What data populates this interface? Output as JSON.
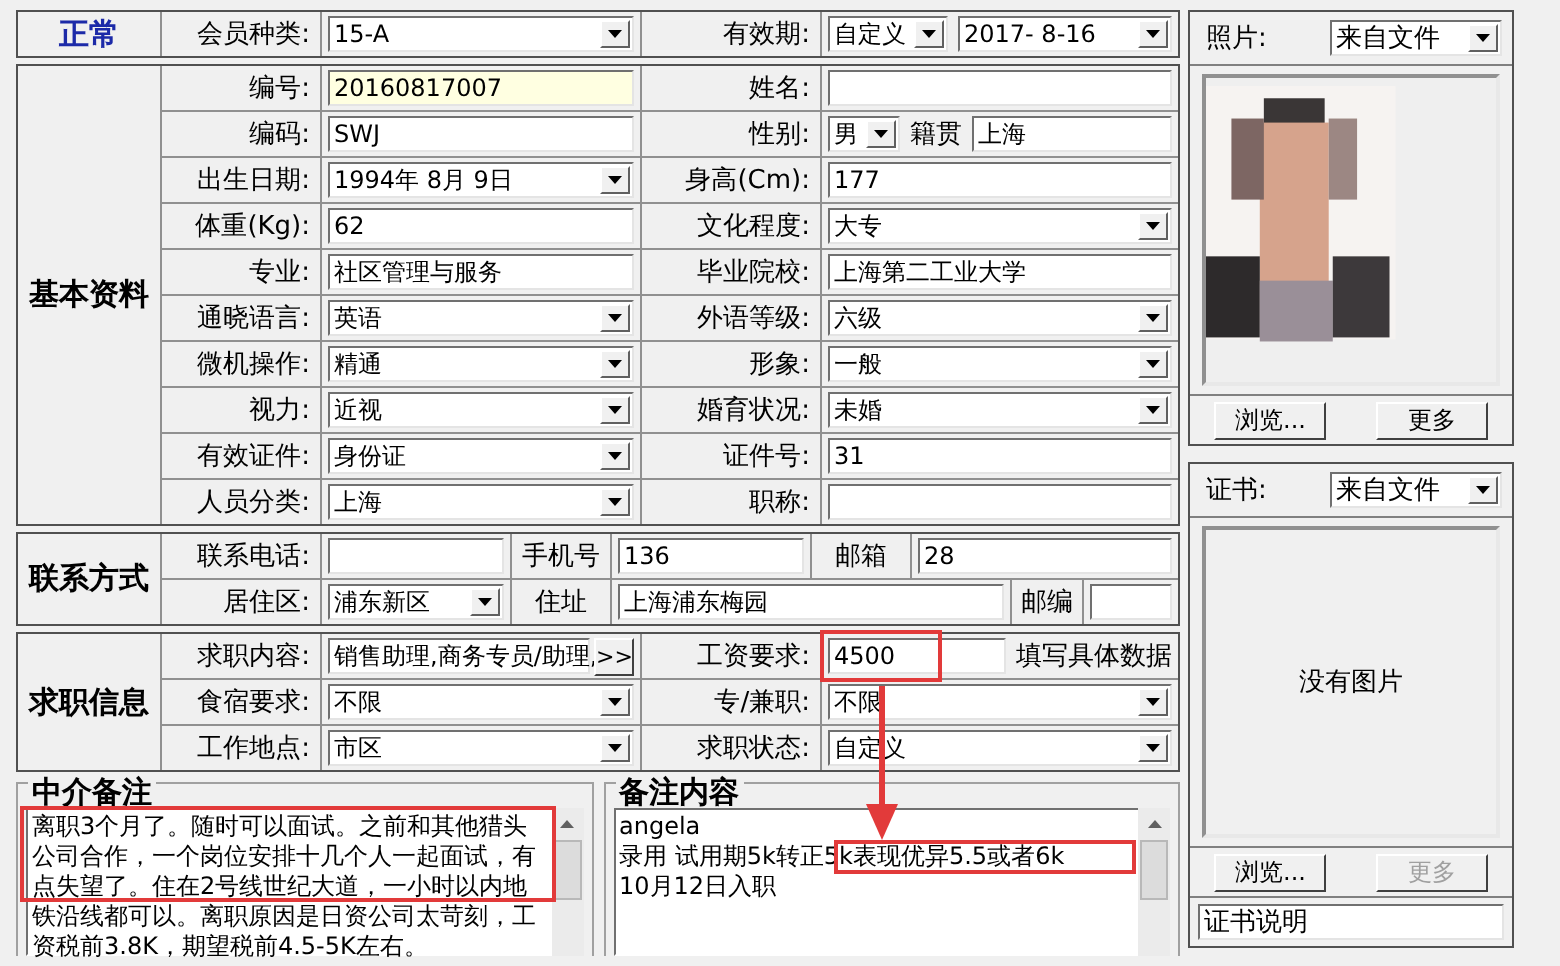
{
  "sections": [
    {
      "kind": "status",
      "title": "正常",
      "rows": [
        [
          {
            "kind": "label",
            "text": "会员种类:"
          },
          {
            "kind": "select",
            "value": "15-A"
          },
          {
            "kind": "label",
            "text": "有效期:"
          },
          {
            "kind": "group",
            "items": [
              {
                "kind": "select",
                "value": "自定义"
              },
              {
                "kind": "select",
                "value": "2017- 8-16"
              }
            ]
          }
        ]
      ]
    },
    {
      "kind": "main",
      "title": "基本资料",
      "rows": [
        [
          {
            "kind": "label",
            "text": "编号:"
          },
          {
            "kind": "locked",
            "value": "20160817007"
          },
          {
            "kind": "label",
            "text": "姓名:"
          },
          {
            "kind": "input"
          }
        ],
        [
          {
            "kind": "label",
            "text": "编码:"
          },
          {
            "kind": "input",
            "value": "SWJ"
          },
          {
            "kind": "label",
            "text": "性别:"
          },
          {
            "kind": "group",
            "items": [
              {
                "kind": "select",
                "value": "男"
              },
              {
                "kind": "note",
                "text": "籍贯"
              },
              {
                "kind": "input",
                "value": "上海"
              }
            ]
          }
        ],
        [
          {
            "kind": "label",
            "text": "出生日期:"
          },
          {
            "kind": "select",
            "value": "1994年 8月 9日"
          },
          {
            "kind": "label",
            "text": "身高(Cm):"
          },
          {
            "kind": "input",
            "value": "177"
          }
        ],
        [
          {
            "kind": "label",
            "text": "体重(Kg):"
          },
          {
            "kind": "input",
            "value": "62"
          },
          {
            "kind": "label",
            "text": "文化程度:"
          },
          {
            "kind": "select",
            "value": "大专"
          }
        ],
        [
          {
            "kind": "label",
            "text": "专业:"
          },
          {
            "kind": "input",
            "value": "社区管理与服务"
          },
          {
            "kind": "label",
            "text": "毕业院校:"
          },
          {
            "kind": "input",
            "value": "上海第二工业大学"
          }
        ],
        [
          {
            "kind": "label",
            "text": "通晓语言:"
          },
          {
            "kind": "select",
            "value": "英语"
          },
          {
            "kind": "label",
            "text": "外语等级:"
          },
          {
            "kind": "select",
            "value": "六级"
          }
        ],
        [
          {
            "kind": "label",
            "text": "微机操作:"
          },
          {
            "kind": "select",
            "value": "精通"
          },
          {
            "kind": "label",
            "text": "形象:"
          },
          {
            "kind": "select",
            "value": "一般"
          }
        ],
        [
          {
            "kind": "label",
            "text": "视力:"
          },
          {
            "kind": "select",
            "value": "近视"
          },
          {
            "kind": "label",
            "text": "婚育状况:"
          },
          {
            "kind": "select",
            "value": "未婚"
          }
        ],
        [
          {
            "kind": "label",
            "text": "有效证件:"
          },
          {
            "kind": "select",
            "value": "身份证"
          },
          {
            "kind": "label",
            "text": "证件号:"
          },
          {
            "kind": "input",
            "value": "31"
          }
        ],
        [
          {
            "kind": "label",
            "text": "人员分类:"
          },
          {
            "kind": "select",
            "value": "上海"
          },
          {
            "kind": "label",
            "text": "职称:"
          },
          {
            "kind": "input"
          }
        ]
      ]
    },
    {
      "kind": "contact",
      "title": "联系方式",
      "rows": [
        [
          {
            "kind": "label",
            "text": "联系电话:"
          },
          {
            "kind": "input"
          },
          {
            "kind": "label",
            "text": "手机号"
          },
          {
            "kind": "input",
            "value": "136"
          },
          {
            "kind": "label",
            "text": "邮箱"
          },
          {
            "kind": "input",
            "value": "28"
          }
        ],
        [
          {
            "kind": "label",
            "text": "居住区:"
          },
          {
            "kind": "select",
            "value": "浦东新区"
          },
          {
            "kind": "label",
            "text": "住址"
          },
          {
            "kind": "input",
            "value": "上海浦东梅园"
          },
          {
            "kind": "label",
            "text": "邮编"
          },
          {
            "kind": "input"
          }
        ]
      ]
    },
    {
      "kind": "main",
      "title": "求职信息",
      "rows": [
        [
          {
            "kind": "label",
            "text": "求职内容:"
          },
          {
            "kind": "group",
            "items": [
              {
                "kind": "input",
                "value": "销售助理,商务专员/助理,"
              },
              {
                "kind": "button",
                "text": ">>"
              }
            ]
          },
          {
            "kind": "label",
            "text": "工资要求:"
          },
          {
            "kind": "group",
            "items": [
              {
                "kind": "input",
                "value": "4500"
              },
              {
                "kind": "note",
                "text": "填写具体数据"
              }
            ]
          }
        ],
        [
          {
            "kind": "label",
            "text": "食宿要求:"
          },
          {
            "kind": "select",
            "value": "不限"
          },
          {
            "kind": "label",
            "text": "专/兼职:"
          },
          {
            "kind": "select",
            "value": "不限"
          }
        ],
        [
          {
            "kind": "label",
            "text": "工作地点:"
          },
          {
            "kind": "select",
            "value": "市区"
          },
          {
            "kind": "label",
            "text": "求职状态:"
          },
          {
            "kind": "select",
            "value": "自定义"
          }
        ]
      ]
    }
  ],
  "notes": [
    {
      "title": "中介备注",
      "paragraphs": [
        "离职3个月了。随时可以面试。之前和其他猎头公司合作，一个岗位安排十几个人一起面试，有点失望了。住在2号线世纪大道，一小时以内地铁沿线都可以。离职原因是日资公司太苛刻，工资税前3.8K，期望税前4.5-5K左右。"
      ]
    },
    {
      "title": "备注内容",
      "paragraphs": [
        "angela",
        "录用 试用期5k转正5k表现优异5.5或者6k",
        "10月12日入职"
      ]
    }
  ],
  "photo_panel": {
    "label": "照片:",
    "source": "来自文件",
    "buttons": [
      {
        "label": "浏览...",
        "disabled": false
      },
      {
        "label": "更多",
        "disabled": false
      }
    ]
  },
  "certificate_panel": {
    "label": "证书:",
    "source": "来自文件",
    "empty_text": "没有图片",
    "buttons": [
      {
        "label": "浏览...",
        "disabled": false
      },
      {
        "label": "更多",
        "disabled": true
      }
    ],
    "caption": "证书说明"
  }
}
